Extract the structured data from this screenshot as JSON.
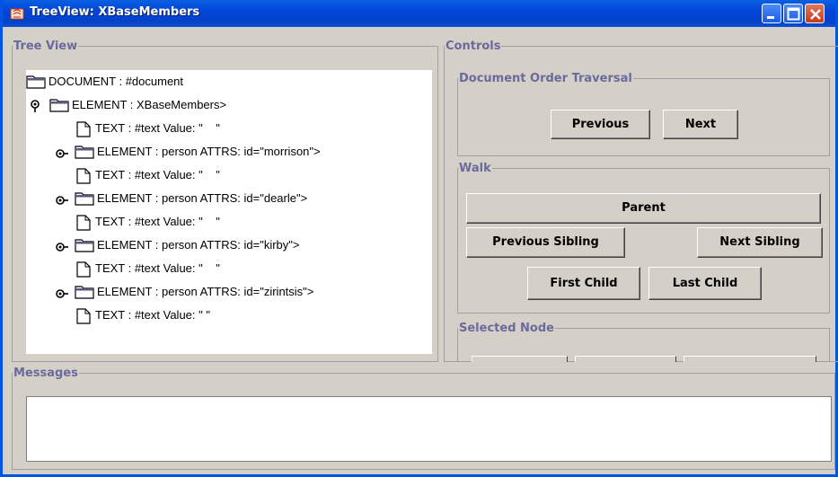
{
  "window": {
    "title": "TreeView: XBaseMembers"
  },
  "tree_view": {
    "title": "Tree View",
    "nodes": [
      {
        "label": "DOCUMENT : #document",
        "icon": "folder-icon"
      },
      {
        "label": "ELEMENT : XBaseMembers>",
        "icon": "folder-icon"
      },
      {
        "label": "TEXT : #text Value: \"    \"",
        "icon": "file-icon"
      },
      {
        "label": "ELEMENT : person ATTRS: id=\"morrison\">",
        "icon": "folder-icon"
      },
      {
        "label": "TEXT : #text Value: \"    \"",
        "icon": "file-icon"
      },
      {
        "label": "ELEMENT : person ATTRS: id=\"dearle\">",
        "icon": "folder-icon"
      },
      {
        "label": "TEXT : #text Value: \"    \"",
        "icon": "file-icon"
      },
      {
        "label": "ELEMENT : person ATTRS: id=\"kirby\">",
        "icon": "folder-icon"
      },
      {
        "label": "TEXT : #text Value: \"    \"",
        "icon": "file-icon"
      },
      {
        "label": "ELEMENT : person ATTRS: id=\"zirintsis\">",
        "icon": "folder-icon"
      },
      {
        "label": "TEXT : #text Value: \" \"",
        "icon": "file-icon"
      }
    ]
  },
  "controls": {
    "title": "Controls",
    "document_order": {
      "title": "Document Order Traversal",
      "previous": "Previous",
      "next": "Next"
    },
    "walk": {
      "title": "Walk",
      "parent": "Parent",
      "previous_sibling": "Previous Sibling",
      "next_sibling": "Next Sibling",
      "first_child": "First Child",
      "last_child": "Last Child"
    },
    "selected_node": {
      "title": "Selected Node"
    }
  },
  "messages": {
    "title": "Messages",
    "text": ""
  },
  "colors": {
    "titlebar": "#0345d8",
    "panel": "#d4d0c8",
    "legend": "#6a6a9c"
  }
}
